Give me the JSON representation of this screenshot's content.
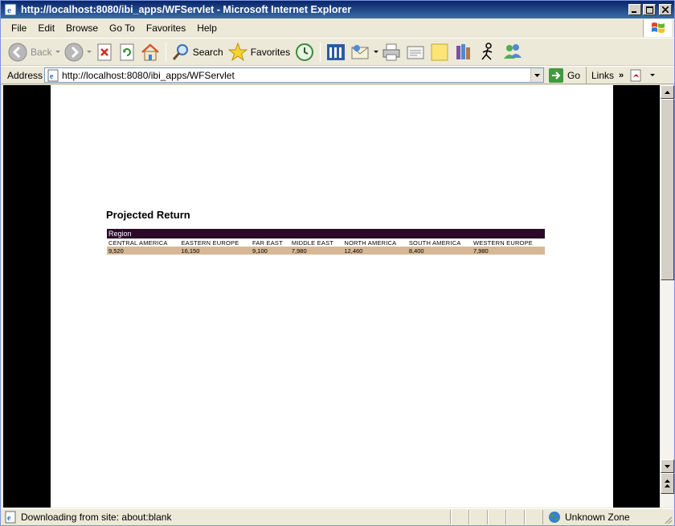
{
  "window": {
    "title": "http://localhost:8080/ibi_apps/WFServlet - Microsoft Internet Explorer"
  },
  "menu": {
    "items": [
      "File",
      "Edit",
      "Browse",
      "Go To",
      "Favorites",
      "Help"
    ]
  },
  "toolbar": {
    "back_label": "Back",
    "search_label": "Search",
    "favorites_label": "Favorites"
  },
  "address": {
    "label": "Address",
    "url": "http://localhost:8080/ibi_apps/WFServlet",
    "go_label": "Go",
    "links_label": "Links"
  },
  "report": {
    "title": "Projected Return",
    "group_label": "Region",
    "columns": [
      "CENTRAL AMERICA",
      "EASTERN EUROPE",
      "FAR EAST",
      "MIDDLE EAST",
      "NORTH AMERICA",
      "SOUTH AMERICA",
      "WESTERN EUROPE"
    ],
    "values": [
      "9,520",
      "16,150",
      "9,100",
      "7,980",
      "12,460",
      "8,400",
      "7,980"
    ]
  },
  "status": {
    "text": "Downloading from site: about:blank",
    "zone": "Unknown Zone"
  },
  "colors": {
    "region_header_bg": "#2b0a29",
    "value_row_bg": "#d6b897",
    "titlebar": "#0a246a"
  }
}
